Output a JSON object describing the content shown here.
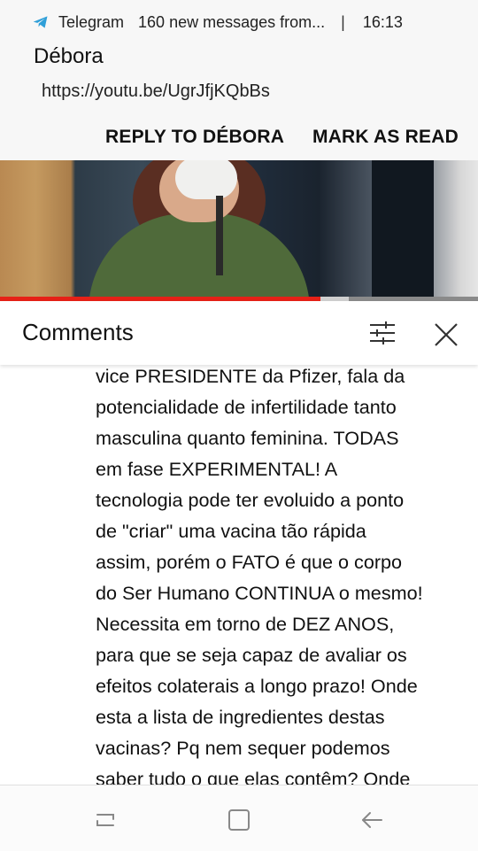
{
  "notification": {
    "app_name": "Telegram",
    "summary": "160 new messages from...",
    "separator": "|",
    "time": "16:13",
    "title": "Débora",
    "message": "https://youtu.be/UgrJfjKQbBs",
    "actions": {
      "reply_label": "REPLY TO DÉBORA",
      "mark_read_label": "MARK AS READ"
    },
    "icon": "telegram-icon"
  },
  "video": {
    "progress_fraction": 0.67,
    "buffered_fraction": 0.73,
    "progress_color": "#e62117"
  },
  "comments": {
    "title": "Comments",
    "filter_icon": "filter-sliders-icon",
    "close_icon": "close-icon",
    "lines": [
      "vice PRESIDENTE da Pfizer, fala da",
      "potencialidade de infertilidade tanto",
      "masculina quanto feminina. TODAS",
      "em fase EXPERIMENTAL! A",
      "tecnologia pode ter evoluido a ponto",
      "de \"criar\" uma vacina tão rápida",
      "assim, porém o FATO é que o corpo",
      "do Ser Humano CONTINUA o mesmo!",
      "Necessita em torno de DEZ ANOS,",
      "para que se seja capaz de avaliar os",
      "efeitos colaterais a longo prazo! Onde",
      "esta a lista de ingredientes destas",
      "vacinas? Pq nem sequer podemos",
      "saber tudo o que elas contêm? Onde"
    ]
  },
  "navbar": {
    "recent_icon": "recent-apps-icon",
    "home_icon": "home-icon",
    "back_icon": "back-arrow-icon"
  }
}
